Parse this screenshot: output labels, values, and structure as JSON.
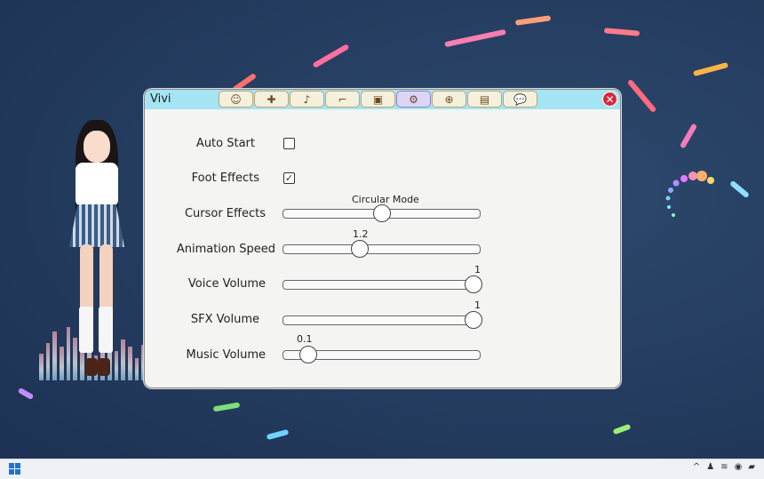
{
  "window": {
    "title": "Vivi",
    "tabs": [
      {
        "icon": "character-portrait-icon",
        "glyph": "☺",
        "active": false
      },
      {
        "icon": "bandage-icon",
        "glyph": "✚",
        "active": false
      },
      {
        "icon": "music-note-icon",
        "glyph": "♪",
        "active": false
      },
      {
        "icon": "sunglasses-icon",
        "glyph": "⌐",
        "active": false
      },
      {
        "icon": "frame-icon",
        "glyph": "▣",
        "active": false
      },
      {
        "icon": "gear-icon",
        "glyph": "⚙",
        "active": true
      },
      {
        "icon": "globe-icon",
        "glyph": "⊕",
        "active": false
      },
      {
        "icon": "notebook-icon",
        "glyph": "▤",
        "active": false
      },
      {
        "icon": "speech-bubble-icon",
        "glyph": "💬",
        "active": false
      }
    ],
    "close_glyph": "✕"
  },
  "settings": {
    "auto_start": {
      "label": "Auto Start",
      "checked": false,
      "mark": ""
    },
    "foot_effects": {
      "label": "Foot Effects",
      "checked": true,
      "mark": "✓"
    },
    "cursor_effects": {
      "label": "Cursor Effects",
      "value_text": "Circular Mode",
      "fraction": 0.5
    },
    "animation_speed": {
      "label": "Animation Speed",
      "value_text": "1.2",
      "fraction": 0.38
    },
    "voice_volume": {
      "label": "Voice Volume",
      "value_text": "1",
      "fraction": 1.0
    },
    "sfx_volume": {
      "label": "SFX Volume",
      "value_text": "1",
      "fraction": 1.0
    },
    "music_volume": {
      "label": "Music Volume",
      "value_text": "0.1",
      "fraction": 0.1
    }
  },
  "colors": {
    "titlebar": "#a5e4f2",
    "window_bg": "#f4f4f2",
    "close": "#d8283a",
    "active_tab": "#dcd5f5"
  },
  "taskbar": {
    "start_icon": "windows-start-icon",
    "tray": [
      "^",
      "♟",
      "≋",
      "◉",
      "▰"
    ]
  }
}
